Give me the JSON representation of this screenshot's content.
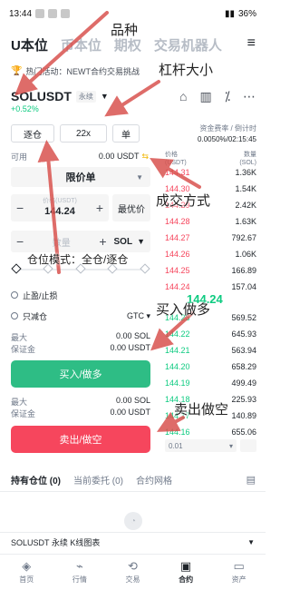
{
  "status": {
    "time": "13:44",
    "battery": "36%"
  },
  "tabs": [
    {
      "label": "U本位"
    },
    {
      "label": "币本位"
    },
    {
      "label": "期权"
    },
    {
      "label": "交易机器人"
    }
  ],
  "banner": "热门活动：NEWT合约交易挑战",
  "symbol": {
    "name": "SOLUSDT",
    "type": "永续",
    "change": "+0.52%"
  },
  "controls": {
    "margin_mode": "逐仓",
    "leverage": "22x",
    "unit": "单"
  },
  "funding": {
    "label": "资金费率 / 倒计时",
    "value": "0.0050%/02:15:45"
  },
  "form": {
    "available_label": "可用",
    "available_value": "0.00 USDT",
    "order_type": "限价单",
    "price_label": "价格(USDT)",
    "price_value": "144.24",
    "best_price": "最优价",
    "qty_placeholder": "数量",
    "qty_unit": "SOL",
    "tp_sl": "止盈/止损",
    "reduce_only": "只减仓",
    "tif": "GTC",
    "buy_max_label": "最大",
    "buy_max_value": "0.00 SOL",
    "buy_margin_label": "保证金",
    "buy_margin_value": "0.00 USDT",
    "buy_button": "买入/做多",
    "sell_max_label": "最大",
    "sell_max_value": "0.00 SOL",
    "sell_margin_label": "保证金",
    "sell_margin_value": "0.00 USDT",
    "sell_button": "卖出/做空"
  },
  "orderbook": {
    "price_header": "价格\n(USDT)",
    "qty_header": "数量\n(SOL)",
    "asks": [
      {
        "price": "144.31",
        "qty": "1.36K"
      },
      {
        "price": "144.30",
        "qty": "1.54K"
      },
      {
        "price": "144.29",
        "qty": "2.42K"
      },
      {
        "price": "144.28",
        "qty": "1.63K"
      },
      {
        "price": "144.27",
        "qty": "792.67"
      },
      {
        "price": "144.26",
        "qty": "1.06K"
      },
      {
        "price": "144.25",
        "qty": "166.89"
      },
      {
        "price": "144.24",
        "qty": "157.04"
      }
    ],
    "mid_price": "144.24",
    "bids": [
      {
        "price": "144.23",
        "qty": "569.52"
      },
      {
        "price": "144.22",
        "qty": "645.93"
      },
      {
        "price": "144.21",
        "qty": "563.94"
      },
      {
        "price": "144.20",
        "qty": "658.29"
      },
      {
        "price": "144.19",
        "qty": "499.49"
      },
      {
        "price": "144.18",
        "qty": "225.93"
      },
      {
        "price": "144.17",
        "qty": "140.89"
      },
      {
        "price": "144.16",
        "qty": "655.06"
      }
    ],
    "depth": "0.01"
  },
  "positions": {
    "tabs": [
      "持有仓位 (0)",
      "当前委托 (0)",
      "合约网格"
    ]
  },
  "kline_bar": "SOLUSDT 永续 K线图表",
  "bottom_nav": [
    {
      "label": "首页",
      "icon": "home-icon"
    },
    {
      "label": "行情",
      "icon": "chart-icon"
    },
    {
      "label": "交易",
      "icon": "exchange-icon"
    },
    {
      "label": "合约",
      "icon": "futures-icon"
    },
    {
      "label": "资产",
      "icon": "wallet-icon"
    }
  ],
  "annotations": {
    "category": "品种",
    "leverage": "杠杆大小",
    "order_method": "成交方式",
    "position_mode": "仓位模式：全仓/逐仓",
    "buy_long": "买入做多",
    "sell_short": "卖出做空"
  },
  "colors": {
    "buy": "#2ebd85",
    "sell": "#f6465d",
    "accent": "#f0b90b",
    "arrow": "#d9534f"
  }
}
